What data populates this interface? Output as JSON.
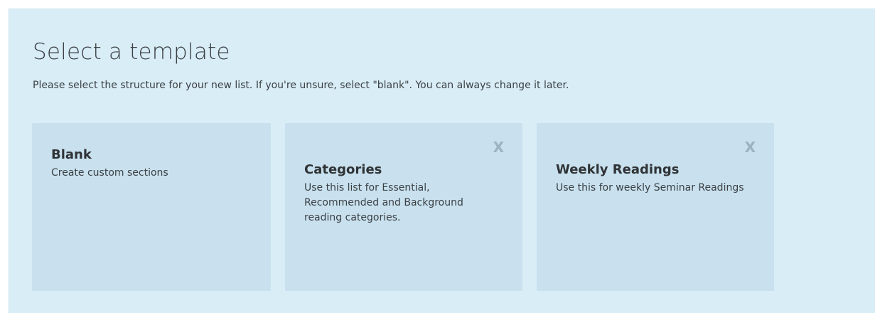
{
  "panel": {
    "title": "Select a template",
    "description": "Please select the structure for your new list. If you're unsure, select \"blank\". You can always change it later."
  },
  "templates": [
    {
      "title": "Blank",
      "description": "Create custom sections",
      "removable": false
    },
    {
      "title": "Categories",
      "description": "Use this list for Essential, Recommended and Background reading categories.",
      "removable": true,
      "remove_label": "X"
    },
    {
      "title": "Weekly Readings",
      "description": "Use this for weekly Seminar Readings",
      "removable": true,
      "remove_label": "X"
    }
  ],
  "colors": {
    "panel_background": "#d9edf6",
    "card_background": "#c9e1ee",
    "text": "#3b4045",
    "remove_icon": "#9cb2bf"
  }
}
